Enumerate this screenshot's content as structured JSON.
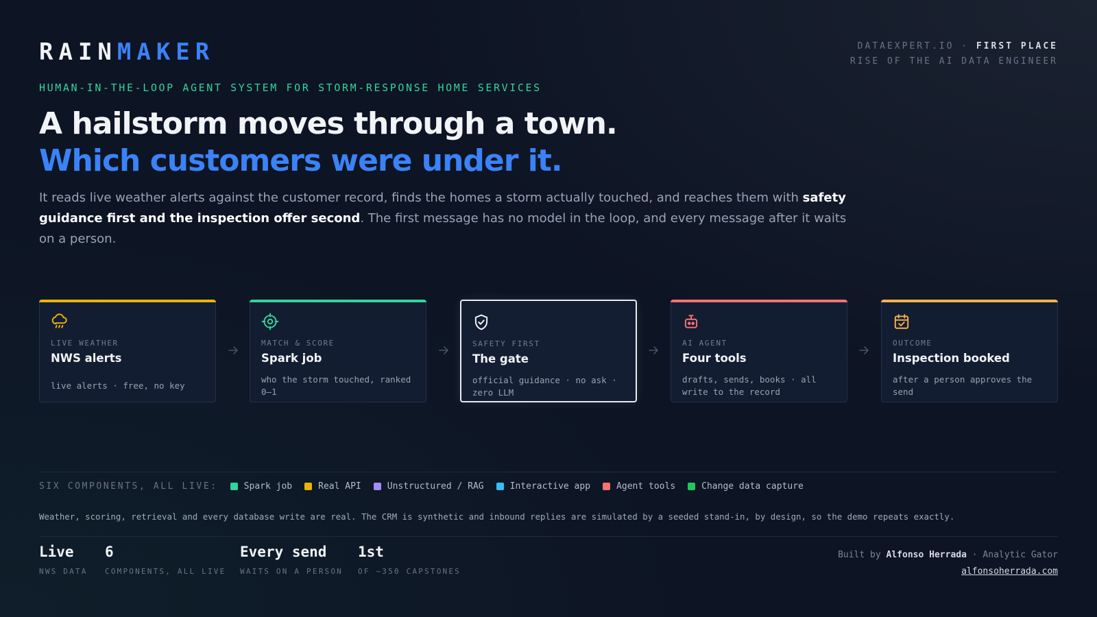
{
  "brand": {
    "part1": "RAIN",
    "part2": "MAKER"
  },
  "award": {
    "org": "DATAEXPERT.IO",
    "sep": " · ",
    "place": "FIRST PLACE",
    "event": "RISE OF THE AI DATA ENGINEER"
  },
  "kicker": "HUMAN-IN-THE-LOOP AGENT SYSTEM FOR STORM-RESPONSE HOME SERVICES",
  "headline": {
    "line1": "A hailstorm moves through a town.",
    "line2": "Which customers were under it."
  },
  "lede": {
    "part1": "It reads live weather alerts against the customer record, finds the homes a storm actually touched, and reaches them with ",
    "bold": "safety guidance first and the inspection offer second",
    "part2": ". The first message has no model in the loop, and every message after it waits on a person."
  },
  "pipeline": [
    {
      "icon": "cloud-hail-icon",
      "accent": "#eab308",
      "label": "LIVE WEATHER",
      "title": "NWS alerts",
      "desc": "live alerts · free, no key"
    },
    {
      "icon": "crosshair-icon",
      "accent": "#34d399",
      "label": "MATCH & SCORE",
      "title": "Spark job",
      "desc": "who the storm touched, ranked 0–1"
    },
    {
      "icon": "shield-check-icon",
      "accent": "#e8ecf2",
      "label": "SAFETY FIRST",
      "title": "The gate",
      "desc": "official guidance · no ask · zero LLM"
    },
    {
      "icon": "robot-icon",
      "accent": "#f87171",
      "label": "AI AGENT",
      "title": "Four tools",
      "desc": "drafts, sends, books · all write to the record"
    },
    {
      "icon": "calendar-check-icon",
      "accent": "#f5b14a",
      "label": "OUTCOME",
      "title": "Inspection booked",
      "desc": "after a person approves the send"
    }
  ],
  "components": {
    "lead": "SIX COMPONENTS, ALL LIVE:",
    "items": [
      {
        "label": "Spark job",
        "color": "#34d399"
      },
      {
        "label": "Real API",
        "color": "#eab308"
      },
      {
        "label": "Unstructured / RAG",
        "color": "#a78bfa"
      },
      {
        "label": "Interactive app",
        "color": "#38bdf8"
      },
      {
        "label": "Agent tools",
        "color": "#f87171"
      },
      {
        "label": "Change data capture",
        "color": "#22c55e"
      }
    ]
  },
  "note": "Weather, scoring, retrieval and every database write are real. The CRM is synthetic and inbound replies are simulated by a seeded stand-in, by design, so the demo repeats exactly.",
  "stats": [
    {
      "value": "Live",
      "label": "NWS DATA"
    },
    {
      "value": "6",
      "label": "COMPONENTS, ALL LIVE"
    },
    {
      "value": "Every send",
      "label": "WAITS ON A PERSON"
    },
    {
      "value": "1st",
      "label": "OF ~350 CAPSTONES"
    }
  ],
  "credit": {
    "prefix": "Built by ",
    "name": "Alfonso Herrada",
    "suffix": " · Analytic Gator",
    "url": "alfonsoherrada.com"
  }
}
